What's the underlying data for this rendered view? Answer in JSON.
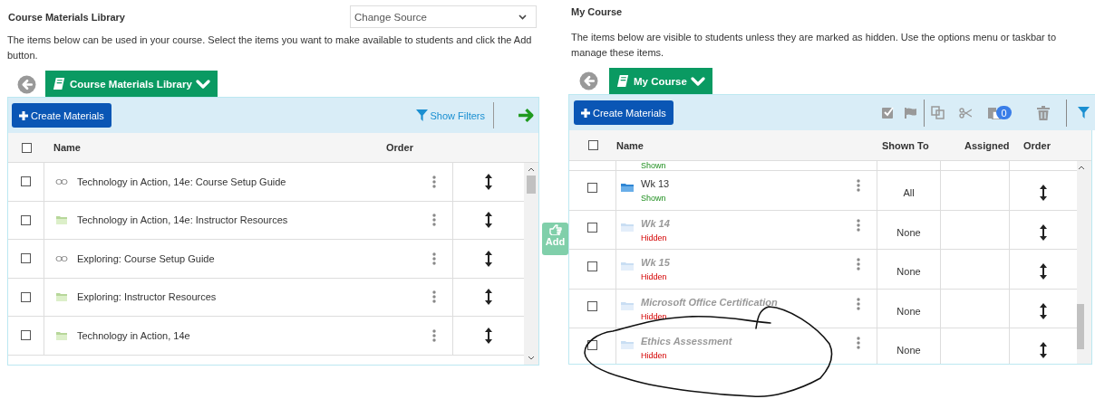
{
  "library": {
    "title": "Course Materials Library",
    "source_select": {
      "value": "Change Source"
    },
    "description": "The items below can be used in your course. Select the items you want to make available to students and click the Add button.",
    "breadcrumb": {
      "label": "Course Materials Library"
    },
    "toolbar": {
      "create_button": "Create Materials",
      "filter_link": "Show Filters"
    },
    "columns": [
      "Name",
      "Order"
    ],
    "select_all_checked": false,
    "rows": [
      {
        "name": "Technology in Action, 14e: Course Setup Guide",
        "kind": "link",
        "checked": false
      },
      {
        "name": "Technology in Action, 14e: Instructor Resources",
        "kind": "folder",
        "checked": false
      },
      {
        "name": "Exploring: Course Setup Guide",
        "kind": "link",
        "checked": false
      },
      {
        "name": "Exploring: Instructor Resources",
        "kind": "folder",
        "checked": false
      },
      {
        "name": "Technology in Action, 14e",
        "kind": "folder",
        "checked": false
      }
    ]
  },
  "add_button": {
    "label": "Add",
    "disabled": true
  },
  "my_course": {
    "title": "My Course",
    "description": "The items below are visible to students unless they are marked as hidden. Use the options menu or taskbar to manage these items.",
    "breadcrumb": {
      "label": "My Course"
    },
    "toolbar": {
      "create_button": "Create Materials",
      "clipboard_count": "0"
    },
    "columns": [
      "Name",
      "Shown To",
      "Assigned",
      "Order"
    ],
    "select_all_checked": false,
    "rows": [
      {
        "kind": "clipped",
        "status": "Shown",
        "hidden": false
      },
      {
        "kind": "folder",
        "name": "Wk 13",
        "status": "Shown",
        "hidden": false,
        "shown_to": "All",
        "checked": false
      },
      {
        "kind": "folder",
        "name": "Wk 14",
        "status": "Hidden",
        "hidden": true,
        "shown_to": "None",
        "checked": false
      },
      {
        "kind": "folder",
        "name": "Wk 15",
        "status": "Hidden",
        "hidden": true,
        "shown_to": "None",
        "checked": false
      },
      {
        "kind": "folder",
        "name": "Microsoft Office Certification",
        "status": "Hidden",
        "hidden": true,
        "shown_to": "None",
        "checked": false
      },
      {
        "kind": "folder",
        "name": "Ethics Assessment",
        "status": "Hidden",
        "hidden": true,
        "shown_to": "None",
        "checked": false
      }
    ]
  },
  "annotation": {
    "kind": "scribble"
  }
}
